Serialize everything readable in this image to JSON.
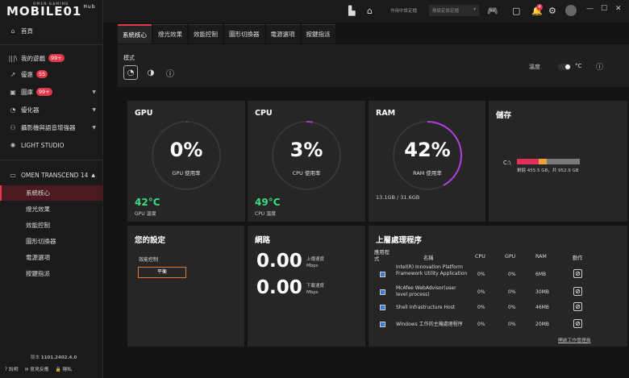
{
  "app": {
    "logo_text": "MOBILE01",
    "hub": "Hub",
    "logo_small": "OMEN GAMING"
  },
  "sidebar": {
    "items": [
      {
        "icon": "home-icon",
        "glyph": "⌂",
        "label": "首頁"
      },
      {
        "icon": "library-icon",
        "glyph": "|||\\",
        "label": "我的遊戲",
        "badge": "99+"
      },
      {
        "icon": "deals-icon",
        "glyph": "↗",
        "label": "優惠",
        "badge": "55"
      },
      {
        "icon": "gallery-icon",
        "glyph": "▣",
        "label": "圖庫",
        "badge": "99+"
      },
      {
        "icon": "optimizer-icon",
        "glyph": "◔",
        "label": "優化器"
      },
      {
        "icon": "camera-icon",
        "glyph": "⚇",
        "label": "攝影機與語音增強器"
      },
      {
        "icon": "light-icon",
        "glyph": "✺",
        "label": "LIGHT STUDIO"
      }
    ],
    "device": {
      "icon": "laptop-icon",
      "label": "OMEN TRANSCEND 14"
    },
    "subitems": [
      "系統核心",
      "燈光效果",
      "效能控制",
      "圖形切換器",
      "電源選項",
      "按鍵指派"
    ],
    "version_label": "版本",
    "version": "1101.2402.4.0",
    "footer": [
      "說明",
      "意見反應",
      "隱私"
    ]
  },
  "topbar": {
    "profile_label": "作用中設定檔",
    "profile_placeholder": "無設定設定檔",
    "notif_count": "4"
  },
  "tabs": [
    "系統核心",
    "燈光效果",
    "效能控制",
    "圖形切換器",
    "電源選項",
    "按鍵指派"
  ],
  "mode": {
    "label": "模式",
    "temp_label": "溫度",
    "unit": "°C"
  },
  "gpu": {
    "title": "GPU",
    "usage": 0,
    "usage_text": "0%",
    "usage_label": "GPU 使用率",
    "temp": "42°C",
    "temp_label": "GPU 溫度",
    "color": "#7a3aa8"
  },
  "cpu": {
    "title": "CPU",
    "usage": 3,
    "usage_text": "3%",
    "usage_label": "CPU 使用率",
    "temp": "49°C",
    "temp_label": "CPU 溫度",
    "color": "#a240c8"
  },
  "ram": {
    "title": "RAM",
    "usage": 42,
    "usage_text": "42%",
    "usage_label": "RAM 使用率",
    "detail": "13.1GB / 31.6GB",
    "color": "#b23ee0"
  },
  "storage": {
    "title": "儲存",
    "drive": "C:\\",
    "used_fraction": 0.48,
    "text": "剩餘 455.5 GB，共 952.9 GB"
  },
  "settings": {
    "title": "您的設定",
    "perf_label": "效能控制",
    "perf_value": "平衡"
  },
  "network": {
    "title": "網路",
    "upload": "0.00",
    "upload_label": "上傳速度",
    "download": "0.00",
    "download_label": "下載速度",
    "unit": "Mbps"
  },
  "processes": {
    "title": "上層處理程序",
    "headers": {
      "app": "應用程式",
      "name": "名稱",
      "cpu": "CPU",
      "gpu": "GPU",
      "ram": "RAM",
      "action": "動作"
    },
    "rows": [
      {
        "name": "Intel(R) Innovation Platform Framework Utility Application",
        "cpu": "0%",
        "gpu": "0%",
        "ram": "6MB"
      },
      {
        "name": "McAfee WebAdvisor(user level process)",
        "cpu": "0%",
        "gpu": "0%",
        "ram": "30MB"
      },
      {
        "name": "Shell Infrastructure Host",
        "cpu": "0%",
        "gpu": "0%",
        "ram": "46MB"
      },
      {
        "name": "Windows 工作的主機處理程序",
        "cpu": "0%",
        "gpu": "0%",
        "ram": "20MB"
      }
    ],
    "link": "開啟工作管理員"
  }
}
